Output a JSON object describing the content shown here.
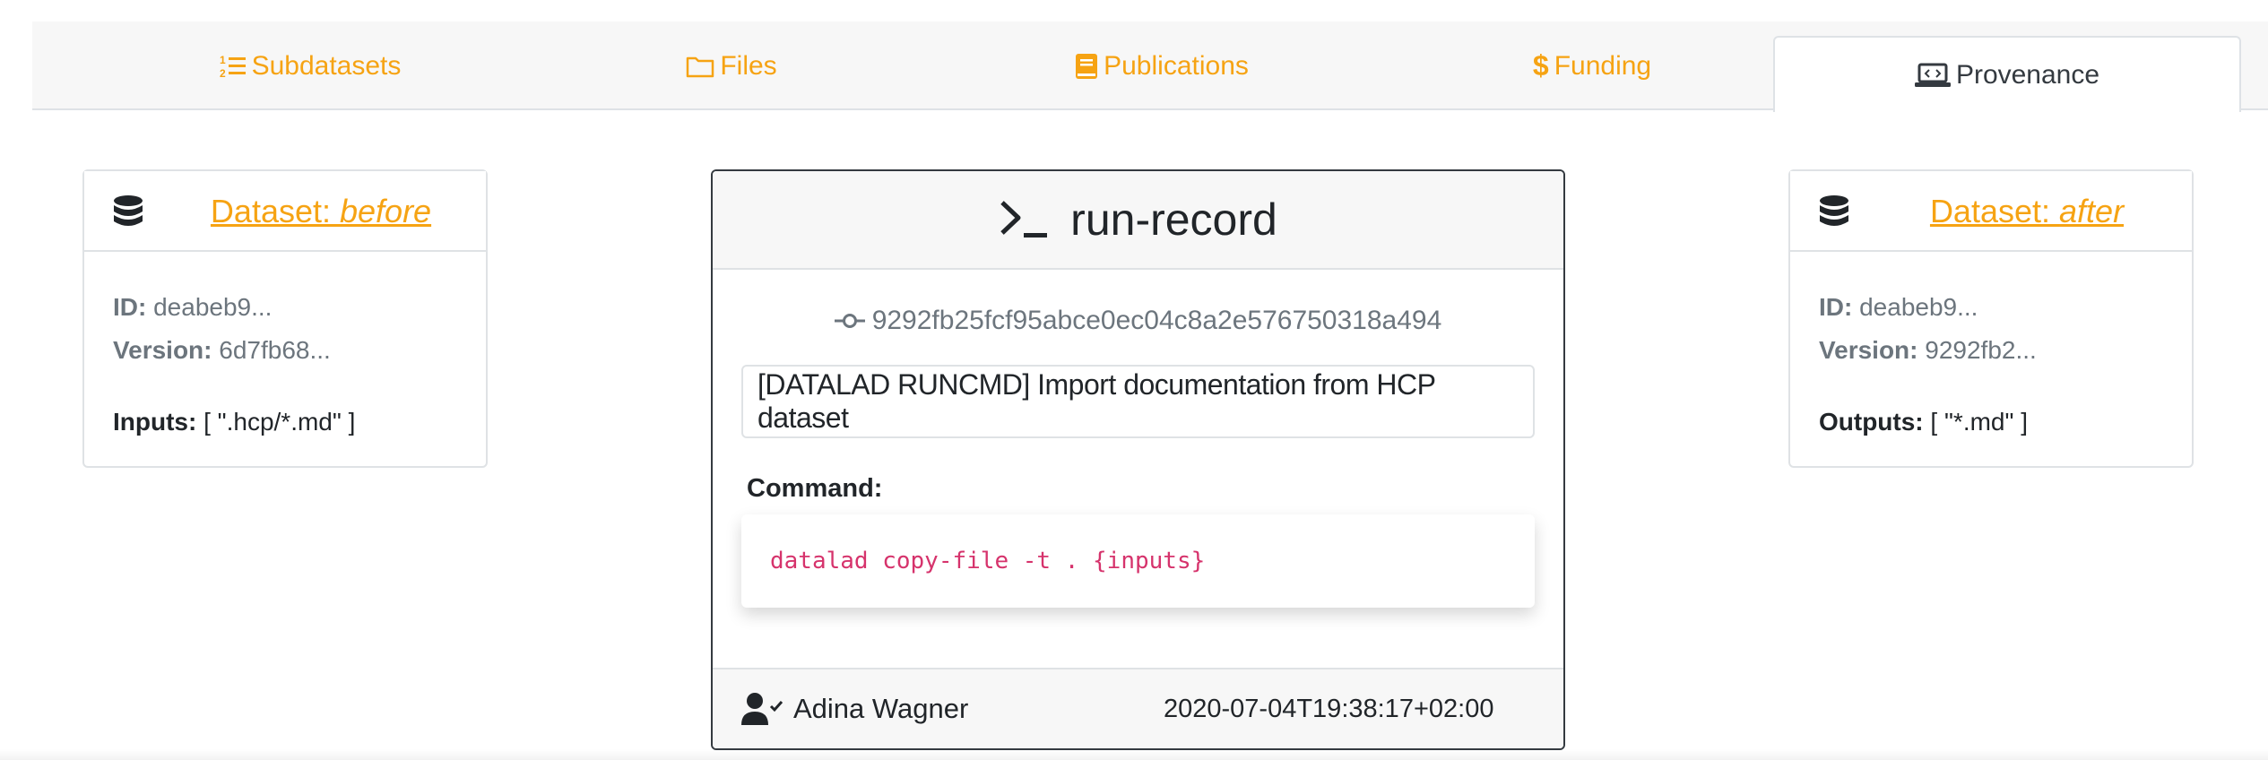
{
  "tabs": [
    {
      "label": "Subdatasets",
      "icon": "list-ol-icon"
    },
    {
      "label": "Files",
      "icon": "folder-icon"
    },
    {
      "label": "Publications",
      "icon": "book-icon"
    },
    {
      "label": "Funding",
      "icon": "dollar-icon"
    },
    {
      "label": "Provenance",
      "icon": "laptop-code-icon",
      "active": true
    }
  ],
  "colors": {
    "accent": "#f6a313",
    "code": "#d6336c",
    "muted": "#6c757d"
  },
  "before": {
    "title_prefix": "Dataset: ",
    "title_em": "before",
    "id_label": "ID:",
    "id_value": " deabeb9...",
    "version_label": "Version:",
    "version_value": " 6d7fb68...",
    "io_label": "Inputs:",
    "io_value": " [ \".hcp/*.md\" ]"
  },
  "after": {
    "title_prefix": "Dataset: ",
    "title_em": "after",
    "id_label": "ID:",
    "id_value": " deabeb9...",
    "version_label": "Version:",
    "version_value": " 9292fb2...",
    "io_label": "Outputs:",
    "io_value": " [ \"*.md\" ]"
  },
  "run": {
    "title": "run-record",
    "commit": "9292fb25fcf95abce0ec04c8a2e576750318a494",
    "message": "[DATALAD RUNCMD] Import documentation from HCP dataset",
    "command_label": "Command:",
    "command": "datalad copy-file -t . {inputs}",
    "author": "Adina Wagner",
    "date": "2020-07-04T19:38:17+02:00"
  }
}
